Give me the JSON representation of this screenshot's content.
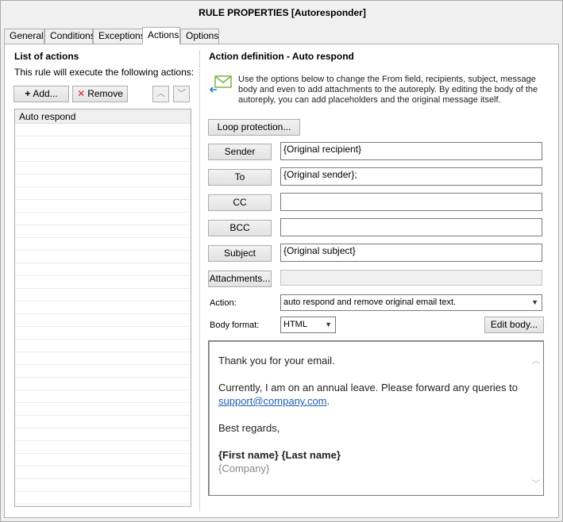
{
  "window": {
    "title": "RULE PROPERTIES [Autoresponder]"
  },
  "tabs": [
    {
      "label": "General"
    },
    {
      "label": "Conditions"
    },
    {
      "label": "Exceptions"
    },
    {
      "label": "Actions",
      "active": true
    },
    {
      "label": "Options"
    }
  ],
  "actions_list": {
    "title": "List of actions",
    "subtitle": "This rule will execute the following actions:",
    "add_label": "Add...",
    "remove_label": "Remove",
    "items": [
      {
        "label": "Auto respond"
      }
    ]
  },
  "definition": {
    "title": "Action definition - Auto respond",
    "info": "Use the options below to change the From field, recipients, subject, message body and even to add attachments to the autoreply. By editing the body of the autoreply, you can add placeholders and the original message itself.",
    "loop_protection_label": "Loop protection...",
    "sender": {
      "label": "Sender",
      "value": "{Original recipient}"
    },
    "to": {
      "label": "To",
      "value": "{Original sender};"
    },
    "cc": {
      "label": "CC",
      "value": ""
    },
    "bcc": {
      "label": "BCC",
      "value": ""
    },
    "subject": {
      "label": "Subject",
      "value": "{Original subject}"
    },
    "attachments": {
      "label": "Attachments...",
      "value": ""
    },
    "action": {
      "label": "Action:",
      "value": "auto respond and remove original email text."
    },
    "body_format": {
      "label": "Body format:",
      "value": "HTML"
    },
    "edit_body_label": "Edit body...",
    "body": {
      "greeting": "Thank you for your email.",
      "line1": "Currently, I am on an annual leave. Please forward any queries to",
      "link": "support@company.com",
      "link_suffix": ".",
      "closing": "Best regards,",
      "name": "{First name} {Last name}",
      "company": "{Company}"
    }
  },
  "colors": {
    "accent_icon": "#7cb342",
    "link": "#1f5fb0"
  }
}
